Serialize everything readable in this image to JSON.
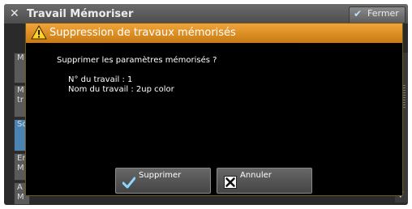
{
  "background_window": {
    "title": "Travail Mémoriser",
    "close_label": "Fermer",
    "list_items": [
      {
        "label": "M"
      },
      {
        "label": "M\ntr"
      },
      {
        "label": "Sc"
      },
      {
        "label": "Er\nM"
      },
      {
        "label": "A\nM"
      }
    ]
  },
  "dialog": {
    "title": "Suppression de travaux mémorisés",
    "message": "Supprimer les paramètres mémorisés ?",
    "job_number": "N° du travail : 1",
    "job_name": "Nom du travail : 2up color",
    "delete_label": "Supprimer",
    "cancel_label": "Annuler"
  },
  "colors": {
    "header_accent": "#e08f1e",
    "dialog_bg": "#000000",
    "selected_item": "#4b83b3"
  },
  "icons": {
    "title_icon": "tools-icon",
    "warning": "warning-icon",
    "delete": "checkmark-icon",
    "cancel": "close-box-icon"
  }
}
